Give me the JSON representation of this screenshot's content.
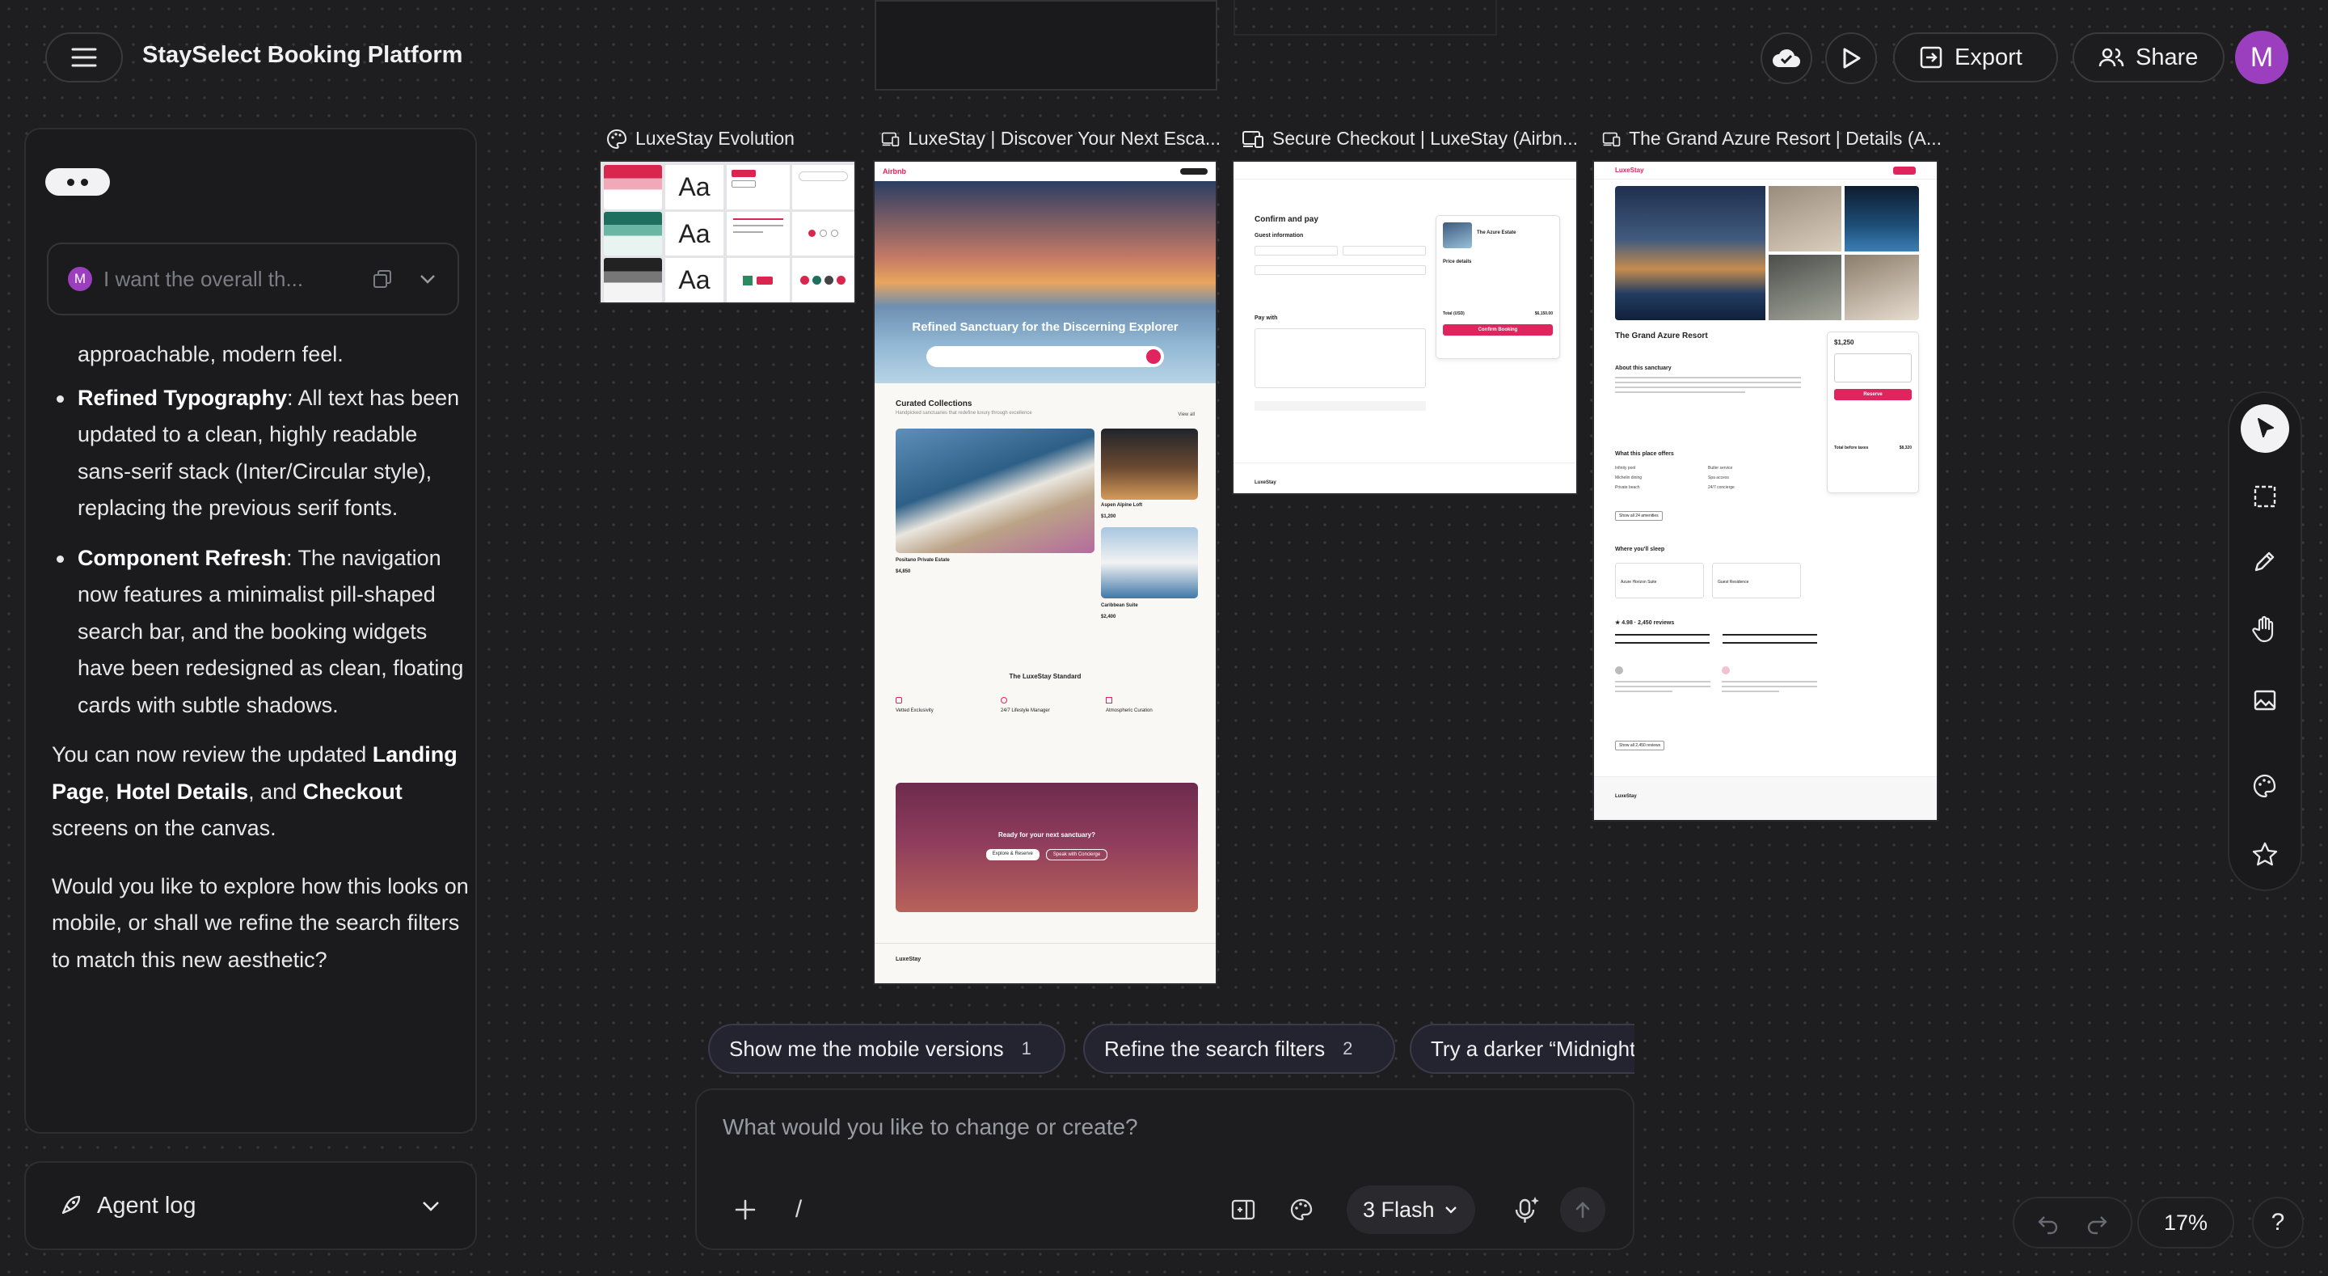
{
  "app": {
    "title": "StaySelect Booking Platform"
  },
  "header": {
    "export_label": "Export",
    "share_label": "Share",
    "avatar_initial": "M"
  },
  "chat": {
    "user_message": "I want the overall th...",
    "user_initial": "M",
    "intro": "approachable, modern feel.",
    "bullets": [
      {
        "title": "Refined Typography",
        "text": ": All text has been updated to a clean, highly readable sans-serif stack (Inter/Circular style), replacing the previous serif fonts."
      },
      {
        "title": "Component Refresh",
        "text": ": The navigation now features a minimalist pill-shaped search bar, and the booking widgets have been redesigned as clean, floating cards with subtle shadows."
      }
    ],
    "review_prefix": "You can now review the updated ",
    "review_page1": "Landing Page",
    "review_sep1": ", ",
    "review_page2": "Hotel Details",
    "review_sep2": ", and ",
    "review_page3": "Checkout",
    "review_suffix": " screens on the canvas.",
    "question": "Would you like to explore how this looks on mobile, or shall we refine the search filters to match this new aesthetic?"
  },
  "agent_log": {
    "label": "Agent log"
  },
  "frames": [
    {
      "label": "LuxeStay Evolution"
    },
    {
      "label": "LuxeStay | Discover Your Next Esca..."
    },
    {
      "label": "Secure Checkout | LuxeStay (Airbn..."
    },
    {
      "label": "The Grand Azure Resort | Details (A..."
    }
  ],
  "evolution": {
    "aa": "Aa"
  },
  "landing": {
    "logo": "Airbnb",
    "hero_title": "Refined Sanctuary for the Discerning Explorer",
    "collections_title": "Curated Collections",
    "collections_sub": "Handpicked sanctuaries that redefine luxury through excellence",
    "view_all": "View all",
    "card1_name": "Positano Private Estate",
    "card1_price": "$4,850",
    "card2_name": "Aspen Alpine Loft",
    "card2_price": "$1,200",
    "card3_name": "Caribbean Suite",
    "card3_price": "$2,400",
    "standard_title": "The LuxeStay Standard",
    "features": [
      "Vetted Exclusivity",
      "24/7 Lifestyle Manager",
      "Atmospheric Curation"
    ],
    "cta_title": "Ready for your next sanctuary?",
    "cta_btn1": "Explore & Reserve",
    "cta_btn2": "Speak with Concierge",
    "footer_logo": "LuxeStay"
  },
  "checkout": {
    "title": "Confirm and pay",
    "guest_info": "Guest information",
    "pay_with": "Pay with",
    "hotel": "The Azure Estate",
    "price_details": "Price details",
    "total_label": "Total (USD)",
    "total_value": "$6,150.00",
    "confirm_btn": "Confirm Booking",
    "footer_logo": "LuxeStay"
  },
  "details": {
    "logo": "LuxeStay",
    "title": "The Grand Azure Resort",
    "about": "About this sanctuary",
    "offers": "What this place offers",
    "amenities": [
      "Infinity pool",
      "Michelin dining",
      "Private beach",
      "Butler service",
      "Spa access",
      "24/7 concierge"
    ],
    "show_amenities": "Show all 24 amenities",
    "sleep": "Where you'll sleep",
    "rooms": [
      "Azure Horizon Suite",
      "Guest Residence"
    ],
    "reviews": "★ 4.98 · 2,450 reviews",
    "show_reviews": "Show all 2,450 reviews",
    "price": "$1,250",
    "reserve": "Reserve",
    "total_label": "Total before taxes",
    "total_value": "$8,320",
    "footer_logo": "LuxeStay"
  },
  "suggestions": [
    {
      "label": "Show me the mobile versions",
      "num": "1"
    },
    {
      "label": "Refine the search filters",
      "num": "2"
    },
    {
      "label": "Try a darker “Midnight”"
    }
  ],
  "composer": {
    "placeholder": "What would you like to change or create?",
    "slash": "/",
    "model": "3 Flash"
  },
  "zoom": {
    "level": "17%"
  },
  "help": {
    "label": "?"
  },
  "colors": {
    "accent": "#e0245e",
    "background": "#1e1e20",
    "panel": "#1b1b1d",
    "avatar": "#9c3fbf"
  }
}
